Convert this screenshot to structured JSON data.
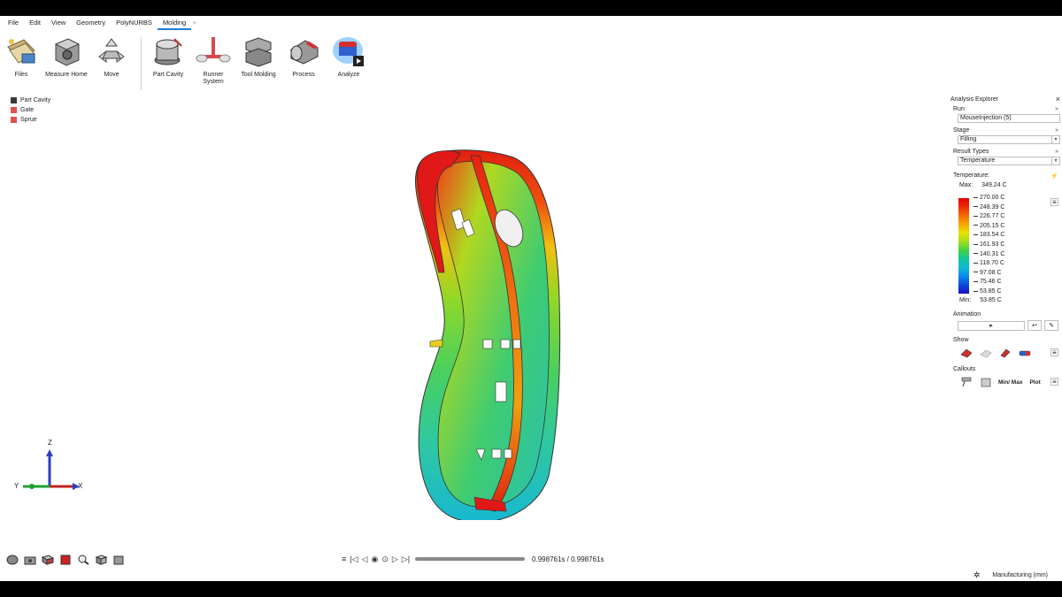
{
  "menu": {
    "items": [
      "File",
      "Edit",
      "View",
      "Geometry",
      "PolyNURBS",
      "Molding"
    ],
    "active": "Molding",
    "plus": "+"
  },
  "ribbon": {
    "files": "Files",
    "measure": "Measure Home",
    "move": "Move",
    "part_cavity": "Part Cavity",
    "runner_system": "Runner System",
    "tool_molding": "Tool Molding",
    "process": "Process",
    "analyze": "Analyze"
  },
  "layers": [
    {
      "label": "Part Cavity",
      "color": "#3a3a3a"
    },
    {
      "label": "Gate",
      "color": "#e05050"
    },
    {
      "label": "Sprue",
      "color": "#e05050"
    }
  ],
  "triad": {
    "z": "Z",
    "y": "Y",
    "x": "X"
  },
  "playback": {
    "timecode": "0.998761s / 0.998761s",
    "progress": 1.0
  },
  "status": {
    "units": "Manufacturing (mm)"
  },
  "explorer": {
    "title": "Analysis Explorer",
    "run_label": "Run",
    "run_value": "MouseInjection (5)",
    "stage_label": "Stage",
    "stage_value": "Filling",
    "result_types_label": "Result Types",
    "result_types_value": "Temperature",
    "temperature_label": "Temperature:",
    "max_label": "Max:",
    "max_value": "349.24 C",
    "min_label": "Min:",
    "min_value": "53.85 C",
    "legend_values": [
      "270.00 C",
      "248.39 C",
      "226.77 C",
      "205.15 C",
      "183.54 C",
      "161.93 C",
      "140.31 C",
      "118.70 C",
      "97.08 C",
      "75.46 C",
      "53.85 C"
    ],
    "animation_label": "Animation",
    "show_label": "Show",
    "callouts_label": "Callouts",
    "minmax_label": "Min/ Max",
    "plot_label": "Plot"
  },
  "colors": {
    "accent": "#1d7fd8",
    "legend_top": "#e60000",
    "legend_bottom": "#1a10c8"
  }
}
